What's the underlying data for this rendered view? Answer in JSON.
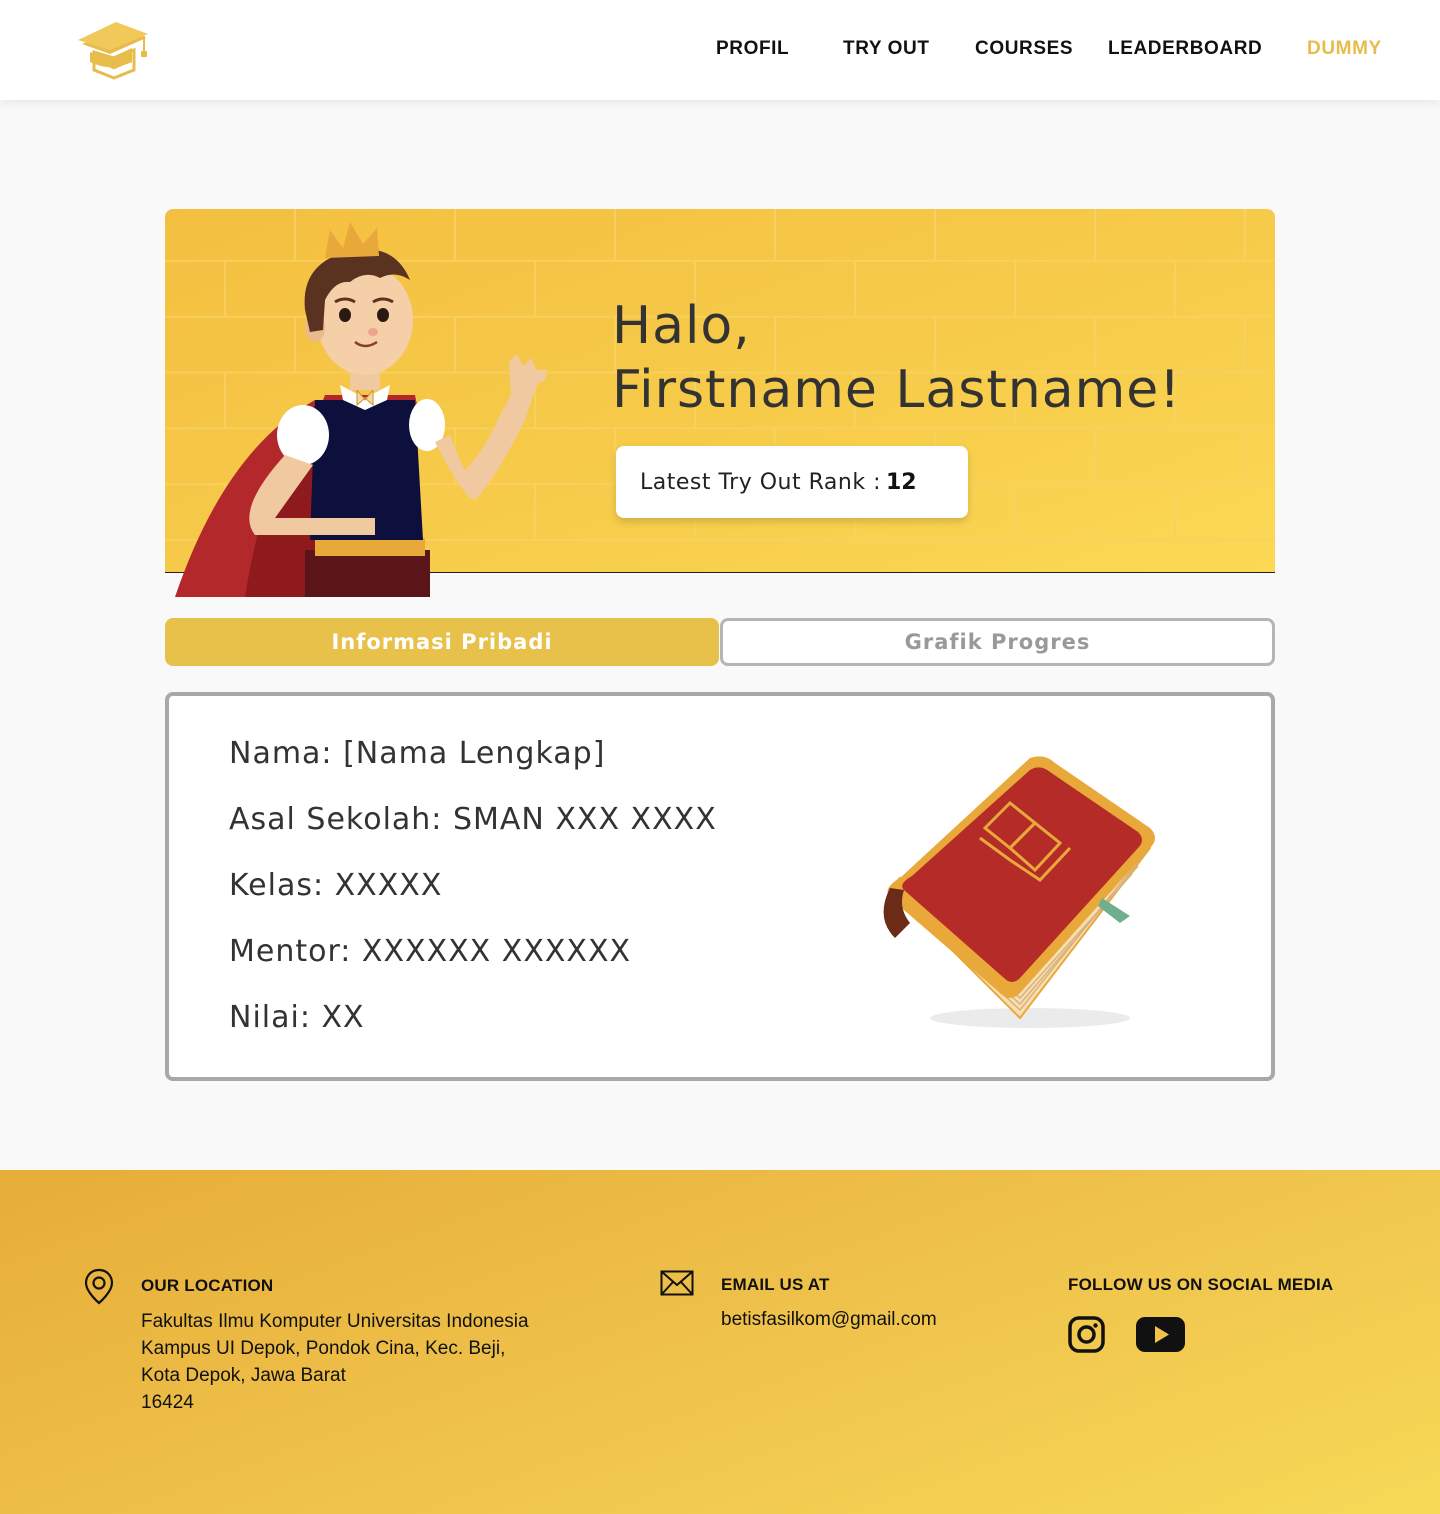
{
  "nav": {
    "logo_icon": "graduation-cap-logo",
    "items": [
      {
        "label": "PROFIL",
        "active": false
      },
      {
        "label": "TRY OUT",
        "active": false
      },
      {
        "label": "COURSES",
        "active": false
      },
      {
        "label": "LEADERBOARD",
        "active": false
      },
      {
        "label": "DUMMY",
        "active": true
      }
    ],
    "active_color": "#e8bc4b"
  },
  "hero": {
    "greeting_line1": "Halo,",
    "greeting_line2": "Firstname Lastname!",
    "rank_label": "Latest Try Out Rank :",
    "rank_value": "12",
    "background_color": "#f7cb4a"
  },
  "tabs": [
    {
      "label": "Informasi Pribadi",
      "active": true
    },
    {
      "label": "Grafik Progres",
      "active": false
    }
  ],
  "profile": {
    "nama": "Nama: [Nama Lengkap]",
    "asal_sekolah": "Asal Sekolah: SMAN XXX XXXX",
    "kelas": "Kelas: XXXXX",
    "mentor": "Mentor: XXXXXX XXXXXX",
    "nilai": "Nilai: XX"
  },
  "footer": {
    "location_heading": "OUR LOCATION",
    "address_lines": [
      "Fakultas Ilmu Komputer Universitas Indonesia",
      "Kampus UI Depok, Pondok Cina, Kec. Beji,",
      "Kota Depok, Jawa Barat",
      "16424"
    ],
    "email_heading": "EMAIL US AT",
    "email": "betisfasilkom@gmail.com",
    "social_heading": "FOLLOW US ON SOCIAL MEDIA",
    "social_icons": [
      "instagram-icon",
      "youtube-icon"
    ]
  }
}
